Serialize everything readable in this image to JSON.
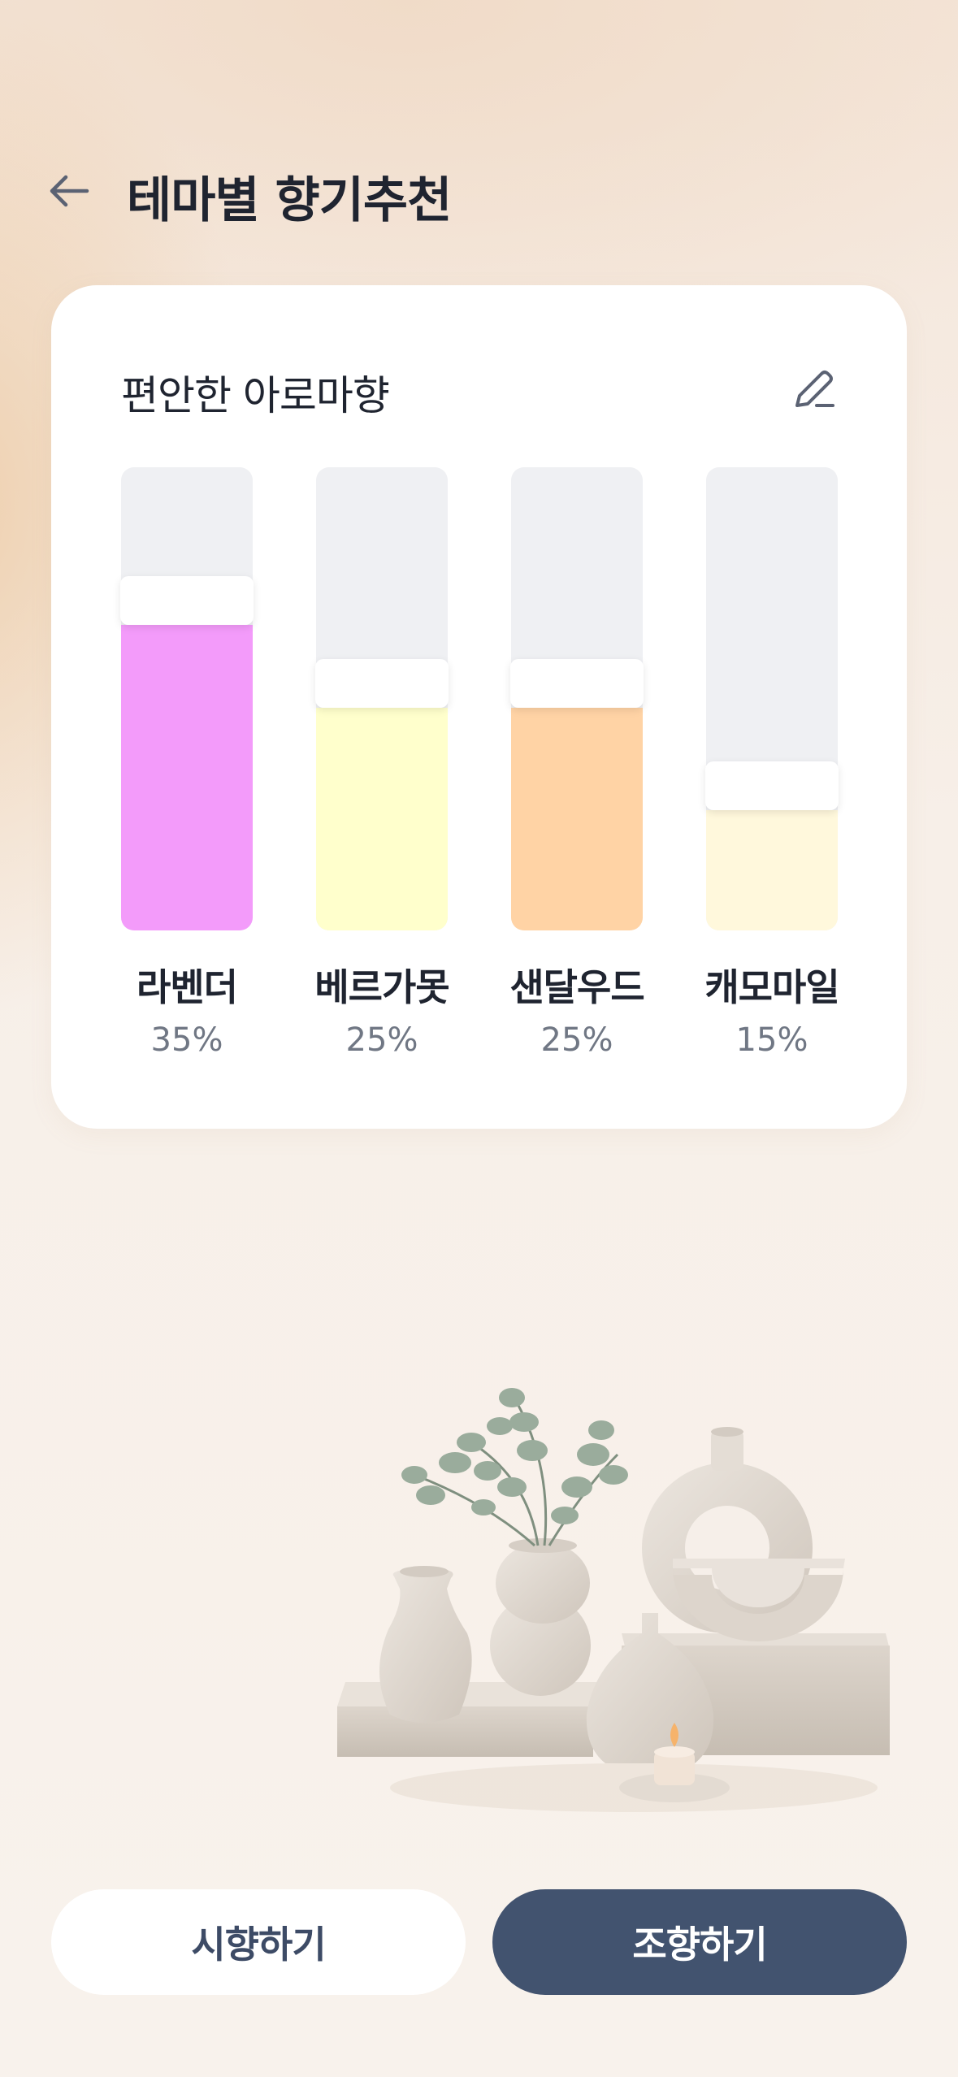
{
  "header": {
    "title": "테마별 향기추천"
  },
  "card": {
    "title": "편안한 아로마향",
    "notes": [
      {
        "name": "라벤더",
        "percent_label": "35%",
        "level": 0.66,
        "color": "#f39bfa"
      },
      {
        "name": "베르가못",
        "percent_label": "25%",
        "level": 0.48,
        "color": "#ffffcc"
      },
      {
        "name": "샌달우드",
        "percent_label": "25%",
        "level": 0.48,
        "color": "#ffd3a5"
      },
      {
        "name": "캐모마일",
        "percent_label": "15%",
        "level": 0.26,
        "color": "#fff8dc"
      }
    ]
  },
  "illustration": {
    "icon": "vases-candle-eucalyptus-illustration"
  },
  "actions": {
    "trial_label": "시향하기",
    "blend_label": "조향하기"
  },
  "colors": {
    "primary": "#42536f",
    "track": "#eff0f3"
  }
}
